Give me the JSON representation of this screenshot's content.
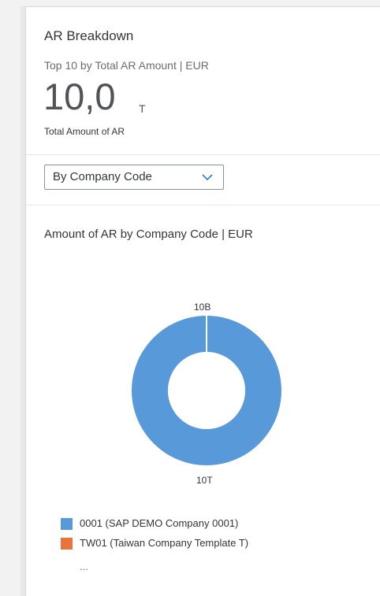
{
  "card": {
    "title": "AR Breakdown",
    "subtitle": "Top 10 by Total AR Amount | EUR",
    "kpi_value": "10,0",
    "kpi_unit": "T",
    "kpi_caption": "Total Amount of AR"
  },
  "filter": {
    "selected": "By Company Code"
  },
  "chart": {
    "title": "Amount of AR by Company Code | EUR",
    "top_label": "10B",
    "bottom_label": "10T"
  },
  "chart_data": {
    "type": "pie",
    "title": "Amount of AR by Company Code | EUR",
    "categories": [
      "0001 (SAP DEMO Company 0001)",
      "TW01 (Taiwan Company Template T)"
    ],
    "values": [
      10000000000000,
      10000000000
    ],
    "data_labels": [
      "10T",
      "10B"
    ],
    "colors": [
      "#5899da",
      "#e8743b"
    ],
    "donut": true
  },
  "legend": {
    "items": [
      {
        "label": "0001 (SAP DEMO Company 0001)",
        "color": "#5899da"
      },
      {
        "label": "TW01 (Taiwan Company Template T)",
        "color": "#e8743b"
      }
    ],
    "more": "..."
  },
  "icons": {
    "dropdown": "chevron-down-icon"
  }
}
